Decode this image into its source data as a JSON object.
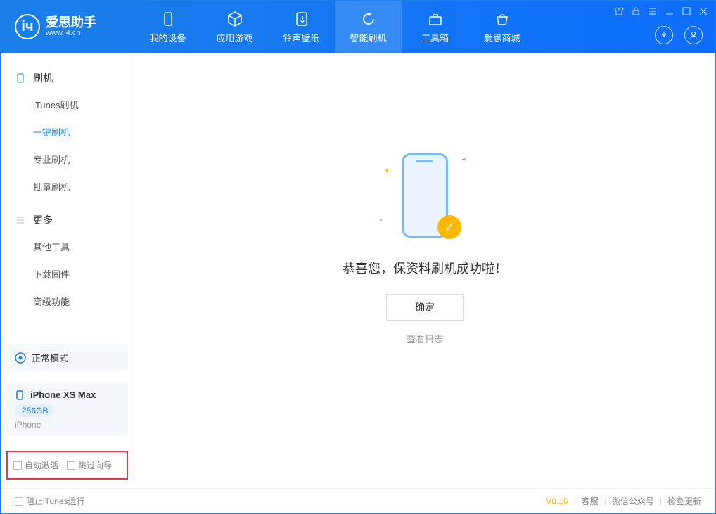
{
  "app": {
    "name": "爱思助手",
    "url": "www.i4.cn"
  },
  "nav": [
    {
      "label": "我的设备"
    },
    {
      "label": "应用游戏"
    },
    {
      "label": "铃声壁纸"
    },
    {
      "label": "智能刷机"
    },
    {
      "label": "工具箱"
    },
    {
      "label": "爱思商城"
    }
  ],
  "sidebar": {
    "section1_title": "刷机",
    "items1": [
      {
        "label": "iTunes刷机"
      },
      {
        "label": "一键刷机"
      },
      {
        "label": "专业刷机"
      },
      {
        "label": "批量刷机"
      }
    ],
    "section2_title": "更多",
    "items2": [
      {
        "label": "其他工具"
      },
      {
        "label": "下载固件"
      },
      {
        "label": "高级功能"
      }
    ],
    "mode_label": "正常模式",
    "device_name": "iPhone XS Max",
    "device_storage": "256GB",
    "device_type": "iPhone",
    "checkbox1": "自动激活",
    "checkbox2": "跳过向导"
  },
  "main": {
    "success_msg": "恭喜您，保资料刷机成功啦！",
    "ok_btn": "确定",
    "log_link": "查看日志"
  },
  "footer": {
    "block_itunes": "阻止iTunes运行",
    "version": "V8.16",
    "link1": "客服",
    "link2": "微信公众号",
    "link3": "检查更新"
  }
}
